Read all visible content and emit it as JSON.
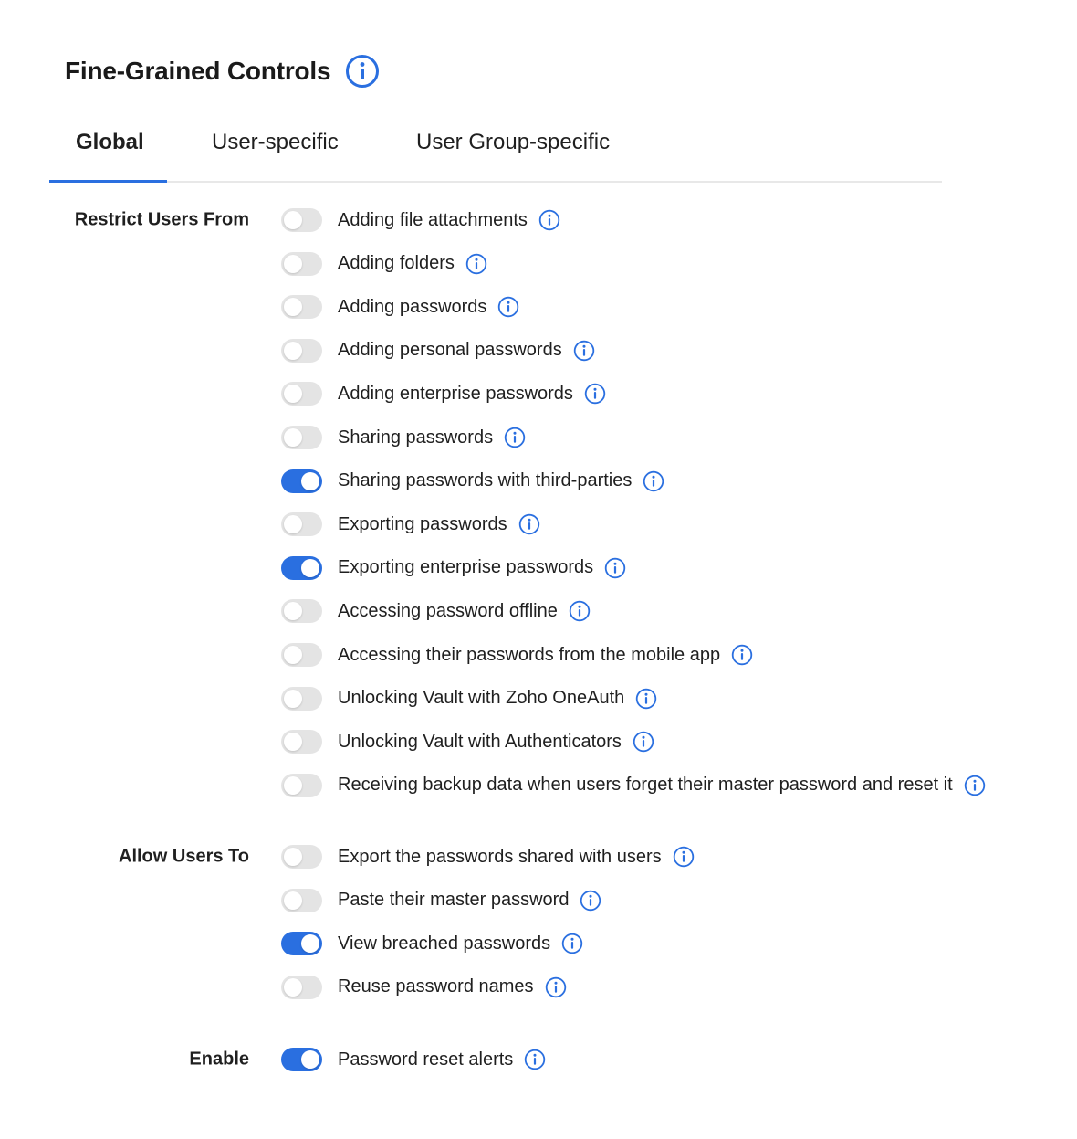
{
  "header": {
    "title": "Fine-Grained Controls",
    "info_icon": "info-icon"
  },
  "tabs": [
    {
      "label": "Global",
      "active": true
    },
    {
      "label": "User-specific",
      "active": false
    },
    {
      "label": "User Group-specific",
      "active": false
    }
  ],
  "colors": {
    "accent": "#2a6fe0",
    "toggle_off": "#e4e4e4",
    "text": "#1f1f1f",
    "divider": "#e8e8e8"
  },
  "sections": [
    {
      "label": "Restrict Users From",
      "items": [
        {
          "label": "Adding file attachments",
          "enabled": false
        },
        {
          "label": "Adding folders",
          "enabled": false
        },
        {
          "label": "Adding passwords",
          "enabled": false
        },
        {
          "label": "Adding personal passwords",
          "enabled": false
        },
        {
          "label": "Adding enterprise passwords",
          "enabled": false
        },
        {
          "label": "Sharing passwords",
          "enabled": false
        },
        {
          "label": "Sharing passwords with third-parties",
          "enabled": true
        },
        {
          "label": "Exporting passwords",
          "enabled": false
        },
        {
          "label": "Exporting enterprise passwords",
          "enabled": true
        },
        {
          "label": "Accessing password offline",
          "enabled": false
        },
        {
          "label": "Accessing their passwords from the mobile app",
          "enabled": false
        },
        {
          "label": "Unlocking Vault with Zoho OneAuth",
          "enabled": false
        },
        {
          "label": "Unlocking Vault with Authenticators",
          "enabled": false
        },
        {
          "label": "Receiving backup data when users forget their master password and reset it",
          "enabled": false
        }
      ]
    },
    {
      "label": "Allow Users To",
      "items": [
        {
          "label": "Export the passwords shared with users",
          "enabled": false
        },
        {
          "label": "Paste their master password",
          "enabled": false
        },
        {
          "label": "View breached passwords",
          "enabled": true
        },
        {
          "label": "Reuse password names",
          "enabled": false
        }
      ]
    },
    {
      "label": "Enable",
      "items": [
        {
          "label": "Password reset alerts",
          "enabled": true
        }
      ]
    }
  ]
}
